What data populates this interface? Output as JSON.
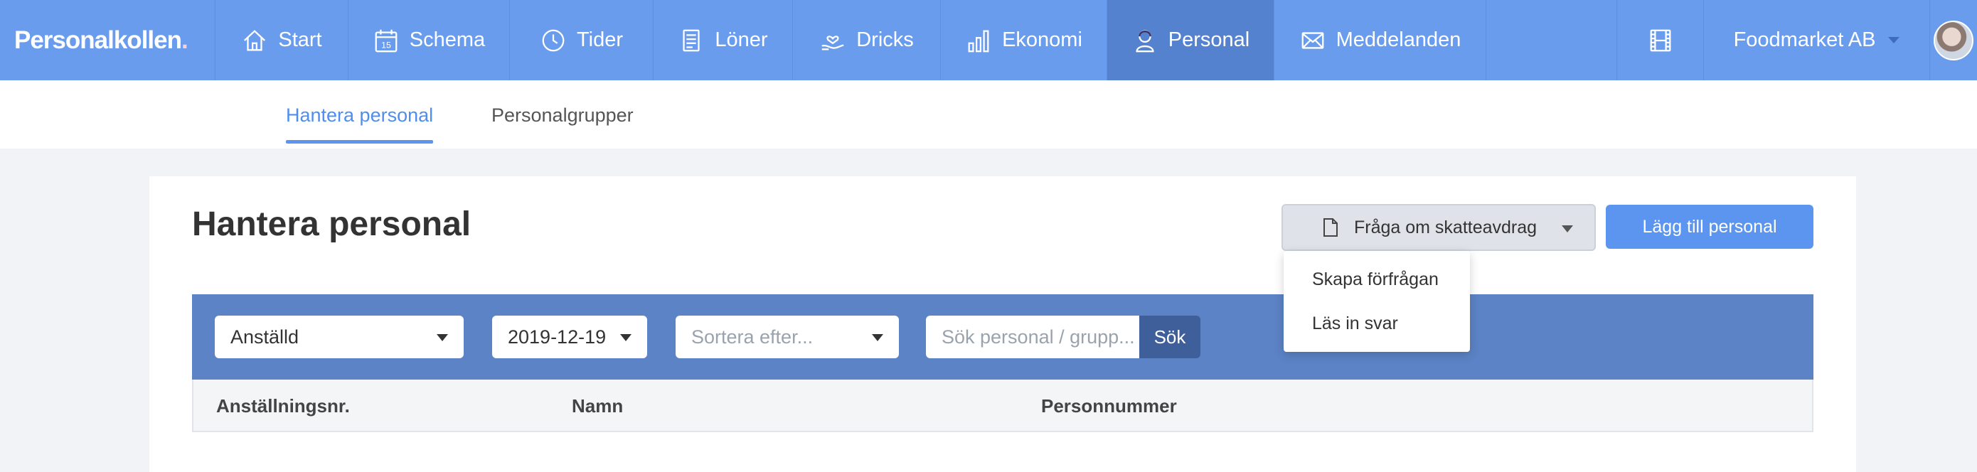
{
  "brand": {
    "name": "Personalkollen",
    "dot": "."
  },
  "nav": {
    "items": [
      {
        "label": "Start",
        "icon": "home-icon"
      },
      {
        "label": "Schema",
        "icon": "calendar-icon",
        "calendar_day": "15"
      },
      {
        "label": "Tider",
        "icon": "clock-icon"
      },
      {
        "label": "Löner",
        "icon": "document-icon"
      },
      {
        "label": "Dricks",
        "icon": "tip-hand-icon"
      },
      {
        "label": "Ekonomi",
        "icon": "bar-chart-icon"
      },
      {
        "label": "Personal",
        "icon": "person-icon",
        "active": true
      },
      {
        "label": "Meddelanden",
        "icon": "envelope-icon"
      }
    ],
    "film_icon": "film-icon",
    "company": "Foodmarket AB"
  },
  "subnav": {
    "tabs": [
      {
        "label": "Hantera personal",
        "active": true
      },
      {
        "label": "Personalgrupper",
        "active": false
      }
    ]
  },
  "page": {
    "title": "Hantera personal",
    "tax_button": "Fråga om skatteavdrag",
    "add_button": "Lägg till personal",
    "tax_menu": [
      "Skapa förfrågan",
      "Läs in svar"
    ]
  },
  "filters": {
    "status": "Anställd",
    "date": "2019-12-19",
    "sort_placeholder": "Sortera efter...",
    "search_placeholder": "Sök personal / grupp...",
    "search_button": "Sök"
  },
  "table": {
    "columns": [
      "Anställningsnr.",
      "Namn",
      "Personnummer"
    ]
  },
  "colors": {
    "nav_bg": "#6a9cee",
    "nav_active": "#5582cf",
    "accent": "#5c95ef",
    "filter_bar": "#5c83c6",
    "search_button": "#3e5f9a"
  }
}
